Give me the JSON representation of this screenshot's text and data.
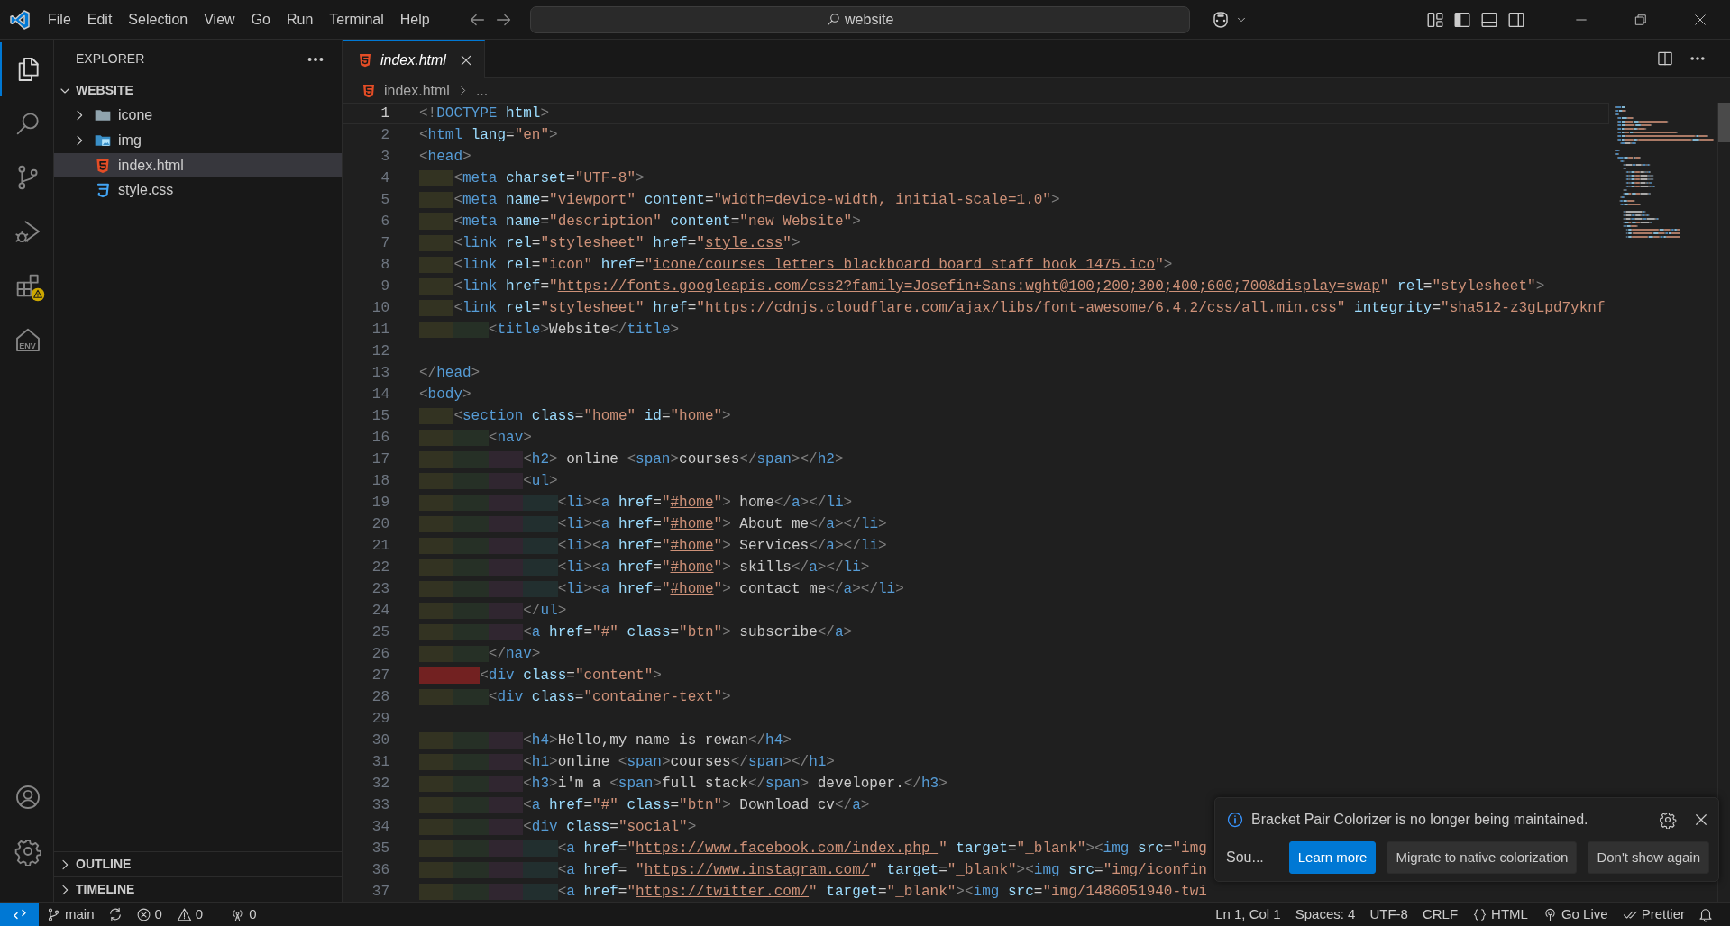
{
  "title_bar": {
    "menus": [
      "File",
      "Edit",
      "Selection",
      "View",
      "Go",
      "Run",
      "Terminal",
      "Help"
    ],
    "search": {
      "value": "website"
    }
  },
  "activity_bar": {
    "items": [
      {
        "kind": "explorer",
        "selected": true,
        "warning": false
      },
      {
        "kind": "search",
        "selected": false,
        "warning": false
      },
      {
        "kind": "source_control",
        "selected": false,
        "warning": false
      },
      {
        "kind": "run",
        "selected": false,
        "warning": false
      },
      {
        "kind": "extensions",
        "selected": false,
        "warning": true
      },
      {
        "kind": "env",
        "label": "ENV",
        "selected": false,
        "warning": false
      }
    ],
    "bottom_items": [
      {
        "kind": "account"
      },
      {
        "kind": "settings"
      }
    ]
  },
  "sidebar": {
    "title": "EXPLORER",
    "root": {
      "label": "WEBSITE",
      "expanded": true
    },
    "tree": [
      {
        "label": "icone",
        "kind": "folder",
        "expanded": false,
        "selected": false
      },
      {
        "label": "img",
        "kind": "image_folder",
        "expanded": false,
        "selected": false
      },
      {
        "label": "index.html",
        "kind": "html",
        "selected": true
      },
      {
        "label": "style.css",
        "kind": "css",
        "selected": false
      }
    ],
    "sections": [
      {
        "label": "OUTLINE",
        "expanded": false
      },
      {
        "label": "TIMELINE",
        "expanded": false
      }
    ]
  },
  "tabs": [
    {
      "label": "index.html",
      "selected": true,
      "preview": true
    }
  ],
  "breadcrumb": {
    "items": [
      "index.html",
      "..."
    ]
  },
  "editor": {
    "lines": [
      {
        "number": "1",
        "text": "<!DOCTYPE html>",
        "current": true
      },
      {
        "number": "2",
        "text": "<html lang=\"en\">",
        "current": false
      },
      {
        "number": "3",
        "text": "<head>",
        "current": false
      },
      {
        "number": "4",
        "text": "    <meta charset=\"UTF-8\">",
        "current": false
      },
      {
        "number": "5",
        "text": "    <meta name=\"viewport\" content=\"width=device-width, initial-scale=1.0\">",
        "current": false
      },
      {
        "number": "6",
        "text": "    <meta name=\"description\" content=\"new Website\">",
        "current": false
      },
      {
        "number": "7",
        "text": "    <link rel=\"stylesheet\" href=\"style.css\">",
        "current": false
      },
      {
        "number": "8",
        "text": "    <link rel=\"icon\" href=\"icone/courses_letters_blackboard_board_staff_book_1475.ico\">",
        "current": false
      },
      {
        "number": "9",
        "text": "    <link href=\"https://fonts.googleapis.com/css2?family=Josefin+Sans:wght@100;200;300;400;600;700&display=swap\" rel=\"stylesheet\">",
        "current": false
      },
      {
        "number": "10",
        "text": "    <link rel=\"stylesheet\" href=\"https://cdnjs.cloudflare.com/ajax/libs/font-awesome/6.4.2/css/all.min.css\" integrity=\"sha512-z3gLpd7yknf",
        "current": false
      },
      {
        "number": "11",
        "text": "        <title>Website</title>",
        "current": false
      },
      {
        "number": "12",
        "current": false
      },
      {
        "number": "13",
        "text": "</head>",
        "current": false
      },
      {
        "number": "14",
        "text": "<body>",
        "current": false
      },
      {
        "number": "15",
        "text": "    <section class=\"home\" id=\"home\">",
        "current": false
      },
      {
        "number": "16",
        "text": "        <nav>",
        "current": false
      },
      {
        "number": "17",
        "text": "            <h2> online <span>courses</span></h2>",
        "current": false
      },
      {
        "number": "18",
        "text": "            <ul>",
        "current": false
      },
      {
        "number": "19",
        "text": "                <li><a href=\"#home\"> home</a></li>",
        "current": false
      },
      {
        "number": "20",
        "text": "                <li><a href=\"#home\"> About me</a></li>",
        "current": false
      },
      {
        "number": "21",
        "text": "                <li><a href=\"#home\"> Services</a></li>",
        "current": false
      },
      {
        "number": "22",
        "text": "                <li><a href=\"#home\"> skills</a></li>",
        "current": false
      },
      {
        "number": "23",
        "text": "                <li><a href=\"#home\"> contact me</a></li>",
        "current": false
      },
      {
        "number": "24",
        "text": "            </ul>",
        "current": false
      },
      {
        "number": "25",
        "text": "            <a href=\"#\" class=\"btn\"> subscribe</a>",
        "current": false
      },
      {
        "number": "26",
        "text": "        </nav>",
        "current": false
      },
      {
        "number": "27",
        "text": "       <div class=\"content\">",
        "current": false
      },
      {
        "number": "28",
        "text": "        <div class=\"container-text\">",
        "current": false
      },
      {
        "number": "29",
        "current": false
      },
      {
        "number": "30",
        "text": "            <h4>Hello,my name is rewan</h4>",
        "current": false
      },
      {
        "number": "31",
        "text": "            <h1>online <span>courses</span></h1>",
        "current": false
      },
      {
        "number": "32",
        "text": "            <h3>i'm a <span>full stack</span> developer.</h3>",
        "current": false
      },
      {
        "number": "33",
        "text": "            <a href=\"#\" class=\"btn\"> Download cv</a>",
        "current": false
      },
      {
        "number": "34",
        "text": "            <div class=\"social\">",
        "current": false
      },
      {
        "number": "35",
        "text": "                <a href=\"https://www.facebook.com/index.php \" target=\"_blank\"><img src=\"img",
        "current": false
      },
      {
        "number": "36",
        "text": "                <a href= \"https://www.instagram.com/\" target=\"_blank\"><img src=\"img/iconfin",
        "current": false
      },
      {
        "number": "37",
        "text": "                <a href=\"https://twitter.com/\" target=\"_blank\"><img src=\"img/1486051940-twi",
        "current": false
      }
    ]
  },
  "notification": {
    "message": "Bracket Pair Colorizer is no longer being maintained.",
    "source": "Sou...",
    "buttons": [
      {
        "label": "Learn more",
        "primary": true
      },
      {
        "label": "Migrate to native colorization",
        "primary": false
      },
      {
        "label": "Don't show again",
        "primary": false
      }
    ]
  },
  "status_bar": {
    "left": [
      {
        "kind": "branch",
        "label": "main"
      },
      {
        "kind": "sync"
      },
      {
        "kind": "errors",
        "label": "0"
      },
      {
        "kind": "warnings",
        "label": "0"
      },
      {
        "kind": "ports",
        "label": "0"
      }
    ],
    "right": [
      {
        "kind": "text",
        "label": "Ln 1, Col 1"
      },
      {
        "kind": "text",
        "label": "Spaces: 4"
      },
      {
        "kind": "text",
        "label": "UTF-8"
      },
      {
        "kind": "text",
        "label": "CRLF"
      },
      {
        "kind": "language",
        "label": "HTML"
      },
      {
        "kind": "live",
        "label": "Go Live"
      },
      {
        "kind": "formatter",
        "label": "Prettier"
      },
      {
        "kind": "notifications"
      }
    ]
  }
}
